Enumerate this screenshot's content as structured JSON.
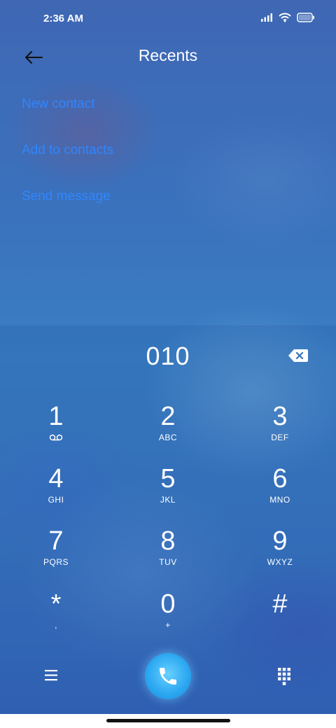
{
  "status_bar": {
    "time": "2:36 AM",
    "icons": [
      "signal-icon",
      "wifi-icon",
      "battery-icon"
    ]
  },
  "header": {
    "title": "Recents",
    "back_icon": "arrow-left-icon"
  },
  "actions": {
    "new_contact": "New contact",
    "add_to_contacts": "Add to contacts",
    "send_message": "Send message"
  },
  "dialer": {
    "number": "010",
    "delete_icon": "backspace-icon"
  },
  "keypad": {
    "keys": [
      {
        "digit": "1",
        "letters": "",
        "sub_icon": "voicemail-icon"
      },
      {
        "digit": "2",
        "letters": "ABC"
      },
      {
        "digit": "3",
        "letters": "DEF"
      },
      {
        "digit": "4",
        "letters": "GHI"
      },
      {
        "digit": "5",
        "letters": "JKL"
      },
      {
        "digit": "6",
        "letters": "MNO"
      },
      {
        "digit": "7",
        "letters": "PQRS"
      },
      {
        "digit": "8",
        "letters": "TUV"
      },
      {
        "digit": "9",
        "letters": "WXYZ"
      },
      {
        "digit": "*",
        "letters": ","
      },
      {
        "digit": "0",
        "letters": "+"
      },
      {
        "digit": "#",
        "letters": ""
      }
    ]
  },
  "bottom_bar": {
    "menu_icon": "hamburger-menu-icon",
    "call_icon": "phone-icon",
    "dialpad_icon": "dialpad-icon"
  },
  "colors": {
    "accent_link": "#2f86ff",
    "call_button": "#2aa6f0",
    "text": "#ffffff"
  }
}
